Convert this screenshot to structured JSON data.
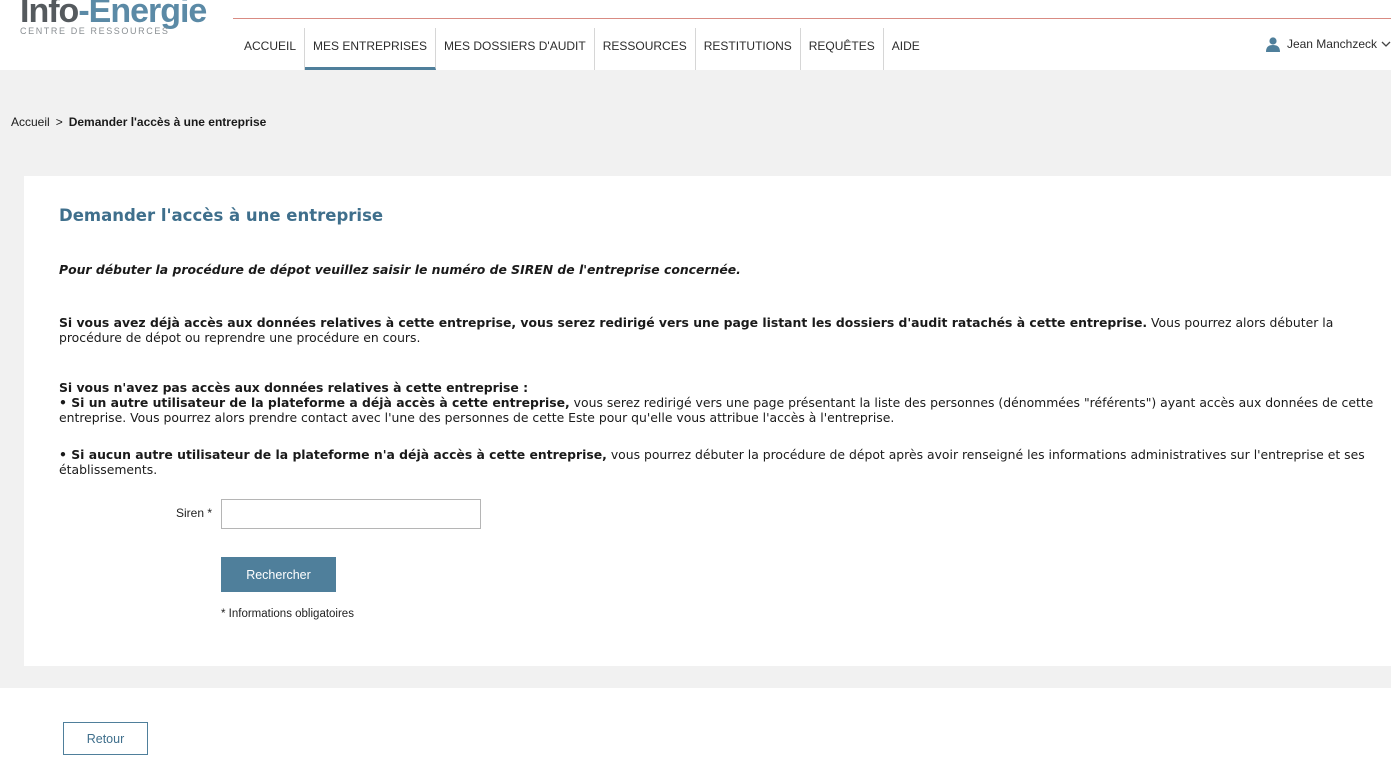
{
  "brand": {
    "name_part1": "Info",
    "name_part2": "-Energie",
    "tagline": "CENTRE DE RESSOURCES"
  },
  "nav": {
    "items": [
      {
        "label": "ACCUEIL"
      },
      {
        "label": "MES ENTREPRISES",
        "active": true
      },
      {
        "label": "MES DOSSIERS D'AUDIT"
      },
      {
        "label": "RESSOURCES"
      },
      {
        "label": "RESTITUTIONS"
      },
      {
        "label": "REQUÊTES"
      },
      {
        "label": "AIDE"
      }
    ]
  },
  "user": {
    "name": "Jean Manchzeck",
    "icon": "user-icon",
    "chevron": "chevron-down-icon"
  },
  "breadcrumb": {
    "home": "Accueil",
    "separator": ">",
    "current": "Demander l'accès à une entreprise"
  },
  "main": {
    "title": "Demander l'accès à une entreprise",
    "intro": "Pour débuter la procédure de dépot veuillez saisir le numéro de SIREN de l'entreprise concernée.",
    "p1_bold": "Si vous avez déjà accès aux données relatives à cette entreprise, vous serez redirigé vers une page listant les dossiers d'audit ratachés à cette entreprise.",
    "p1_rest": " Vous pourrez alors débuter la procédure de dépot ou reprendre une procédure en cours.",
    "p2_heading": "Si vous n'avez pas accès aux données relatives à cette entreprise :",
    "p2_bold": "• Si un autre utilisateur de la plateforme a déjà accès à cette entreprise,",
    "p2_rest": " vous serez redirigé vers une page présentant la liste des personnes (dénommées \"référents\") ayant accès aux données de cette entreprise. Vous pourrez alors prendre contact avec l'une des personnes de cette Este pour qu'elle vous attribue l'accès à l'entreprise.",
    "p3_bold": "• Si aucun autre utilisateur de la plateforme n'a déjà accès à cette entreprise,",
    "p3_rest": " vous pourrez débuter la procédure de dépot après avoir renseigné les informations administratives sur l'entreprise et ses établissements."
  },
  "form": {
    "siren_label": "Siren *",
    "siren_value": "",
    "search_button": "Rechercher",
    "required_note": "* Informations obligatoires"
  },
  "footer": {
    "back_button": "Retour"
  },
  "colors": {
    "accent": "#4f7f9b",
    "title": "#3f6f8c",
    "header_rule": "#d98b83",
    "page_bg": "#f1f1f1"
  }
}
